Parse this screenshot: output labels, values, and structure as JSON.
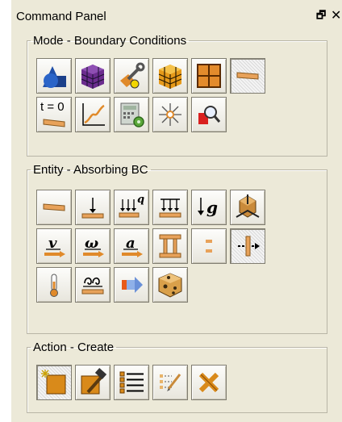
{
  "panel": {
    "title": "Command Panel",
    "pin_glyph": "🗗",
    "close_glyph": "✕"
  },
  "mode": {
    "legend": "Mode - Boundary Conditions",
    "buttons": [
      {
        "icon": "geometry-shapes-icon"
      },
      {
        "icon": "mesh-cube-icon"
      },
      {
        "icon": "tools-wrench-icon"
      },
      {
        "icon": "mesh-orange-cube-icon"
      },
      {
        "icon": "grid-quad-icon"
      },
      {
        "icon": "boundary-condition-surface-icon",
        "selected": true
      },
      {
        "icon": "initial-condition-t0-icon",
        "label": "t = 0"
      },
      {
        "icon": "curve-plot-icon"
      },
      {
        "icon": "calculator-settings-icon"
      },
      {
        "icon": "light-burst-icon"
      },
      {
        "icon": "magnify-inspect-icon"
      }
    ]
  },
  "entity": {
    "legend": "Entity - Absorbing BC",
    "buttons": [
      {
        "icon": "surface-bc-icon"
      },
      {
        "icon": "point-force-icon"
      },
      {
        "icon": "distributed-load-q-icon",
        "label": "q"
      },
      {
        "icon": "pressure-load-icon"
      },
      {
        "icon": "gravity-g-icon",
        "label": "g"
      },
      {
        "icon": "structure-support-icon"
      },
      {
        "icon": "velocity-v-icon",
        "label": "v"
      },
      {
        "icon": "angular-velocity-icon",
        "label": "ω"
      },
      {
        "icon": "acceleration-a-icon",
        "label": "a"
      },
      {
        "icon": "column-support-icon"
      },
      {
        "icon": "displacement-dashed-icon"
      },
      {
        "icon": "absorbing-bc-icon",
        "selected": true
      },
      {
        "icon": "temperature-icon"
      },
      {
        "icon": "heat-flux-icon"
      },
      {
        "icon": "flow-arrow-icon"
      },
      {
        "icon": "porous-solid-icon"
      }
    ]
  },
  "action": {
    "legend": "Action - Create",
    "buttons": [
      {
        "icon": "create-new-icon",
        "selected": true
      },
      {
        "icon": "edit-hammer-icon"
      },
      {
        "icon": "list-items-icon"
      },
      {
        "icon": "edit-list-pencil-icon"
      },
      {
        "icon": "delete-x-icon"
      }
    ]
  }
}
